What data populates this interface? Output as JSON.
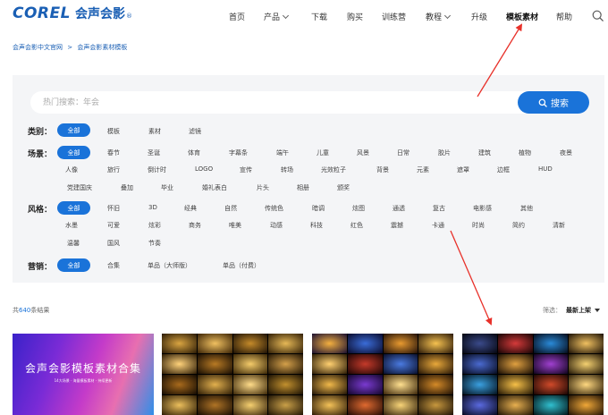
{
  "header": {
    "logo_en": "COREL",
    "logo_zh": "会声会影",
    "logo_mark": "®",
    "nav": [
      {
        "label": "首页",
        "dropdown": false,
        "active": false
      },
      {
        "label": "产品",
        "dropdown": true,
        "active": false
      },
      {
        "label": "下载",
        "dropdown": false,
        "active": false
      },
      {
        "label": "购买",
        "dropdown": false,
        "active": false
      },
      {
        "label": "训练营",
        "dropdown": false,
        "active": false
      },
      {
        "label": "教程",
        "dropdown": true,
        "active": false
      },
      {
        "label": "升级",
        "dropdown": false,
        "active": false
      },
      {
        "label": "模板素材",
        "dropdown": false,
        "active": true
      },
      {
        "label": "帮助",
        "dropdown": false,
        "active": false
      }
    ],
    "search_icon": "search-icon"
  },
  "breadcrumb": {
    "items": [
      "会声会影中文官网",
      ">",
      "会声会影素材模板"
    ]
  },
  "search": {
    "placeholder": "热门搜索：年会",
    "button_label": "搜索"
  },
  "filters": {
    "category": {
      "label": "类别：",
      "tags": [
        "全部",
        "模板",
        "素材",
        "滤镜"
      ]
    },
    "scene": {
      "label": "场景：",
      "rows": [
        [
          "全部",
          "春节",
          "圣诞",
          "体育",
          "字幕条",
          "端午",
          "儿童",
          "风景",
          "日常",
          "胶片",
          "建筑",
          "植物",
          "夜景"
        ],
        [
          "人像",
          "旅行",
          "倒计时",
          "LOGO",
          "宣传",
          "转场",
          "光效粒子",
          "背景",
          "元素",
          "遮罩",
          "边框",
          "HUD"
        ],
        [
          "党建国庆",
          "叠加",
          "毕业",
          "婚礼表白",
          "片头",
          "相册",
          "颁奖"
        ]
      ]
    },
    "style": {
      "label": "风格：",
      "rows": [
        [
          "全部",
          "怀旧",
          "3D",
          "经典",
          "自然",
          "传统色",
          "暗调",
          "炫图",
          "通透",
          "复古",
          "电影感",
          "其他"
        ],
        [
          "水墨",
          "可爱",
          "炫彩",
          "商务",
          "唯美",
          "动感",
          "科技",
          "红色",
          "震撼",
          "卡通",
          "时尚",
          "简约",
          "清新"
        ],
        [
          "温馨",
          "国风",
          "节奏"
        ]
      ]
    },
    "sales": {
      "label": "营销：",
      "tags": [
        "全部",
        "合集",
        "单品（大师版）",
        "单品（付费）"
      ]
    }
  },
  "results": {
    "prefix": "共",
    "count": "640",
    "suffix": "条结果",
    "sort_label": "筛选：",
    "sort_value": "最新上架"
  },
  "thumbnails": [
    {
      "title": "会声会影模板素材合集",
      "subtitle": "14大场景 · 海量模板素材 · 持续更新"
    }
  ],
  "colors": {
    "accent": "#1a73d9",
    "brand": "#1a5fb4",
    "annotation_arrow": "#e8312a"
  }
}
